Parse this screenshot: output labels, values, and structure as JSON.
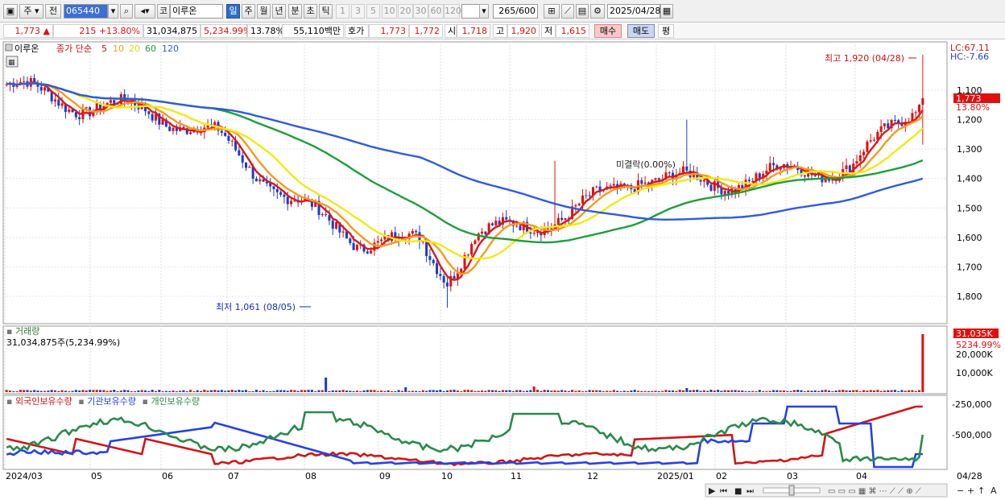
{
  "toolbar": {
    "period_unit": "주",
    "prev_label": "전",
    "code": "065440",
    "name_prefix": "코",
    "stock_name": "이루온",
    "periods": [
      "일",
      "주",
      "월",
      "년",
      "분",
      "초",
      "틱"
    ],
    "active_period": "일",
    "intervals": [
      "1",
      "3",
      "5",
      "10",
      "20",
      "30",
      "60",
      "120"
    ],
    "count_value": "265",
    "count_max": "/600",
    "date": "2025/04/28"
  },
  "quote": {
    "price": "1,773",
    "change": "215",
    "change_pct": "+13.80%",
    "volume": "31,034,875",
    "volume_pct": "5,234.99%",
    "turnover_pct": "13.78%",
    "amount": "55,110백만",
    "bid_label": "호가",
    "ask_price": "1,773",
    "bid_price": "1,772",
    "open_label": "시",
    "open": "1,718",
    "high_label": "고",
    "high": "1,920",
    "low_label": "저",
    "low": "1,615",
    "buy_label": "매수",
    "sell_label": "매도",
    "eval_label": "평"
  },
  "price_panel": {
    "legend_name": "이루온",
    "legend_close": "종가 단순",
    "ma_labels": [
      "5",
      "10",
      "20",
      "60",
      "120"
    ],
    "ma_colors": [
      "#d71a1a",
      "#f59b1a",
      "#f2ea12",
      "#1e9e3a",
      "#2e5be0"
    ],
    "lc": "LC:67.11",
    "hc": "HC:-7.66",
    "high_note": "최고 1,920 (04/28)",
    "low_note": "최저 1,061 (08/05)",
    "mid_note": "미결락(0.00%)",
    "last_price_tag": "1,773",
    "last_pct_tag": "13.80%",
    "y_ticks": [
      "1,800",
      "1,700",
      "1,600",
      "1,500",
      "1,400",
      "1,300",
      "1,200",
      "1,100"
    ]
  },
  "volume_panel": {
    "title": "거래량",
    "summary": "31,034,875주(5,234.99%)",
    "tag_value": "31,035K",
    "tag_pct": "5234.99%",
    "y_ticks": [
      "20,000K",
      "10,000K"
    ]
  },
  "holdings_panel": {
    "series_labels": [
      "외국인보유수량",
      "기관보유수량",
      "개인보유수량"
    ],
    "series_colors": [
      "#d41414",
      "#2442e6",
      "#2a8a4a"
    ],
    "y_ticks": [
      "-250,000",
      "-500,000"
    ]
  },
  "x_axis": {
    "labels": [
      "2024/03",
      "05",
      "06",
      "07",
      "08",
      "09",
      "10",
      "11",
      "12",
      "2025/01",
      "02",
      "03",
      "04"
    ],
    "last_label": "04/28"
  },
  "chart_data": {
    "type": "candlestick",
    "title": "이루온",
    "x_range": [
      "2024/03",
      "2025/04/28"
    ],
    "y_range": [
      1061,
      1920
    ],
    "y_ticks": [
      1100,
      1200,
      1300,
      1400,
      1500,
      1600,
      1700,
      1800
    ],
    "monthly_close_approx": [
      {
        "month": "2024/03",
        "close": 1820
      },
      {
        "month": "2024/04",
        "close": 1750
      },
      {
        "month": "2024/05",
        "close": 1730
      },
      {
        "month": "2024/06",
        "close": 1640
      },
      {
        "month": "2024/07",
        "close": 1430
      },
      {
        "month": "2024/08",
        "close": 1290
      },
      {
        "month": "2024/09",
        "close": 1280
      },
      {
        "month": "2024/10",
        "close": 1320
      },
      {
        "month": "2024/11",
        "close": 1380
      },
      {
        "month": "2024/12",
        "close": 1510
      },
      {
        "month": "2025/01",
        "close": 1480
      },
      {
        "month": "2025/02",
        "close": 1520
      },
      {
        "month": "2025/03",
        "close": 1540
      },
      {
        "month": "2025/04",
        "close": 1773
      }
    ],
    "extremes": {
      "high": 1920,
      "high_date": "04/28",
      "low": 1061,
      "low_date": "08/05"
    },
    "moving_averages": [
      "5",
      "10",
      "20",
      "60",
      "120"
    ],
    "volume_last": 31034875
  }
}
